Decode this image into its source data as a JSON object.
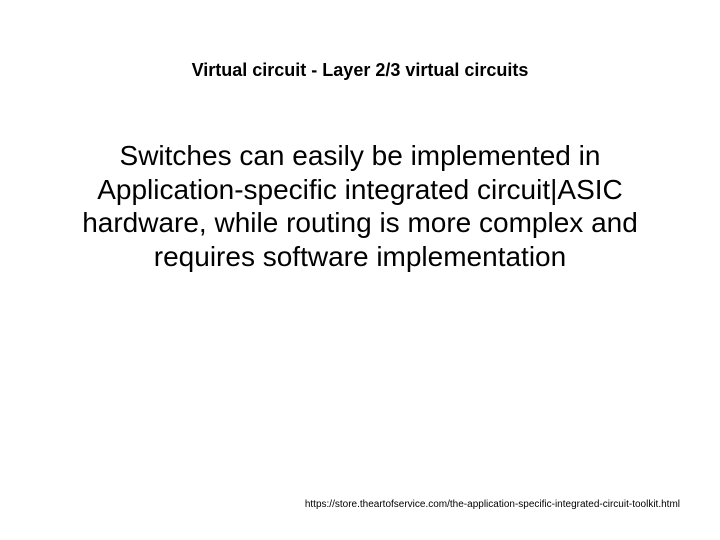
{
  "slide": {
    "title": "Virtual circuit - Layer 2/3 virtual circuits",
    "body": "Switches can easily be implemented in Application-specific integrated circuit|ASIC hardware, while routing is more complex and requires software implementation",
    "footer_url": "https://store.theartofservice.com/the-application-specific-integrated-circuit-toolkit.html"
  }
}
